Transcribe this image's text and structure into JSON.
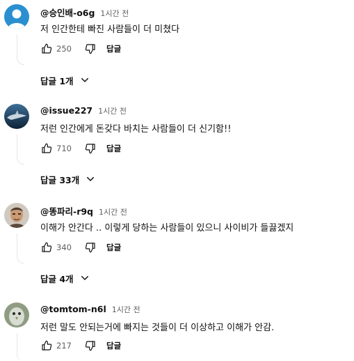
{
  "comments": [
    {
      "author": "@승인배-o6g",
      "time": "1시간 전",
      "text": "저 인간한테 빠진 사람들이 더 미쳤다",
      "likes": "250",
      "reply_label": "답글",
      "replies_label": "답글 1개",
      "avatar_color": "#2a8fd0"
    },
    {
      "author": "@issue227",
      "time": "1시간 전",
      "text": "저런 인간에게 돈갖다 바치는 사람들이 더 신기함!!",
      "likes": "710",
      "reply_label": "답글",
      "replies_label": "답글 33개",
      "avatar_color": "#1d3b5a"
    },
    {
      "author": "@똥파리-r9q",
      "time": "1시간 전",
      "text": "이해가 안간다 .. 이렇게 당하는 사람들이 있으니 사이비가 들끓겠지",
      "likes": "340",
      "reply_label": "답글",
      "replies_label": "답글 4개",
      "avatar_color": "#b08a6a"
    },
    {
      "author": "@tomtom-n6l",
      "time": "1시간 전",
      "text": "저런 말도 안되는거에 빠지는 것들이 더 이상하고 이해가 안감.",
      "likes": "217",
      "reply_label": "답글",
      "replies_label": "",
      "avatar_color": "#7b8a6e"
    }
  ]
}
